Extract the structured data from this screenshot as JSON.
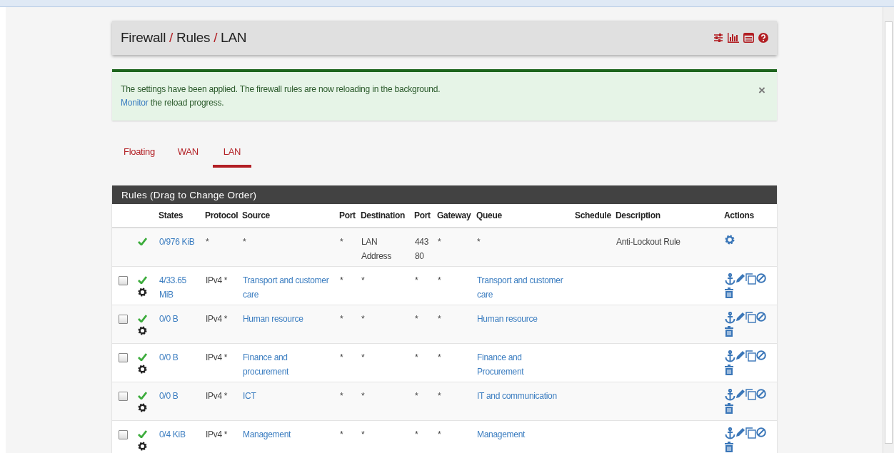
{
  "breadcrumb": [
    {
      "label": "Firewall",
      "separator": "/"
    },
    {
      "label": "Rules",
      "separator": "/"
    },
    {
      "label": "LAN"
    }
  ],
  "alert": {
    "message": "The settings have been applied. The firewall rules are now reloading in the background.",
    "link": "Monitor",
    "link_rest": " the reload progress.",
    "close": "×"
  },
  "tabs": [
    {
      "label": "Floating",
      "selected": false
    },
    {
      "label": "WAN",
      "selected": false
    },
    {
      "label": "LAN",
      "selected": true
    }
  ],
  "panel": {
    "title": "Rules (Drag to Change Order)"
  },
  "columns": [
    "States",
    "Protocol",
    "Source",
    "Port",
    "Destination",
    "Port",
    "Gateway",
    "Queue",
    "Schedule",
    "Description",
    "Actions"
  ],
  "rows": [
    {
      "kind": "fixed",
      "enabled": true,
      "states": "0/976 KiB",
      "protocol": "*",
      "source": "*",
      "source_port": "*",
      "destination": "LAN Address",
      "dest_port": "443 80",
      "gateway": "*",
      "queue": "*",
      "description": "Anti-Lockout Rule"
    },
    {
      "kind": "rule",
      "checked": false,
      "enabled": true,
      "states": "4/33.65 MiB",
      "protocol": "IPv4 *",
      "source": "Transport and customer care",
      "source_port": "*",
      "destination": "*",
      "dest_port": "*",
      "gateway": "*",
      "queue": "Transport and customer care"
    },
    {
      "kind": "rule",
      "checked": false,
      "enabled": true,
      "states": "0/0 B",
      "protocol": "IPv4 *",
      "source": "Human resource",
      "source_port": "*",
      "destination": "*",
      "dest_port": "*",
      "gateway": "*",
      "queue": "Human resource"
    },
    {
      "kind": "rule",
      "checked": false,
      "enabled": true,
      "states": "0/0 B",
      "protocol": "IPv4 *",
      "source": "Finance and procurement",
      "source_port": "*",
      "destination": "*",
      "dest_port": "*",
      "gateway": "*",
      "queue": "Finance and Procurement"
    },
    {
      "kind": "rule",
      "checked": false,
      "enabled": true,
      "states": "0/0 B",
      "protocol": "IPv4 *",
      "source": "ICT",
      "source_port": "*",
      "destination": "*",
      "dest_port": "*",
      "gateway": "*",
      "queue": "IT and communication"
    },
    {
      "kind": "rule",
      "checked": false,
      "enabled": true,
      "states": "0/4 KiB",
      "protocol": "IPv4 *",
      "source": "Management",
      "source_port": "*",
      "destination": "*",
      "dest_port": "*",
      "gateway": "*",
      "queue": "Management"
    }
  ]
}
